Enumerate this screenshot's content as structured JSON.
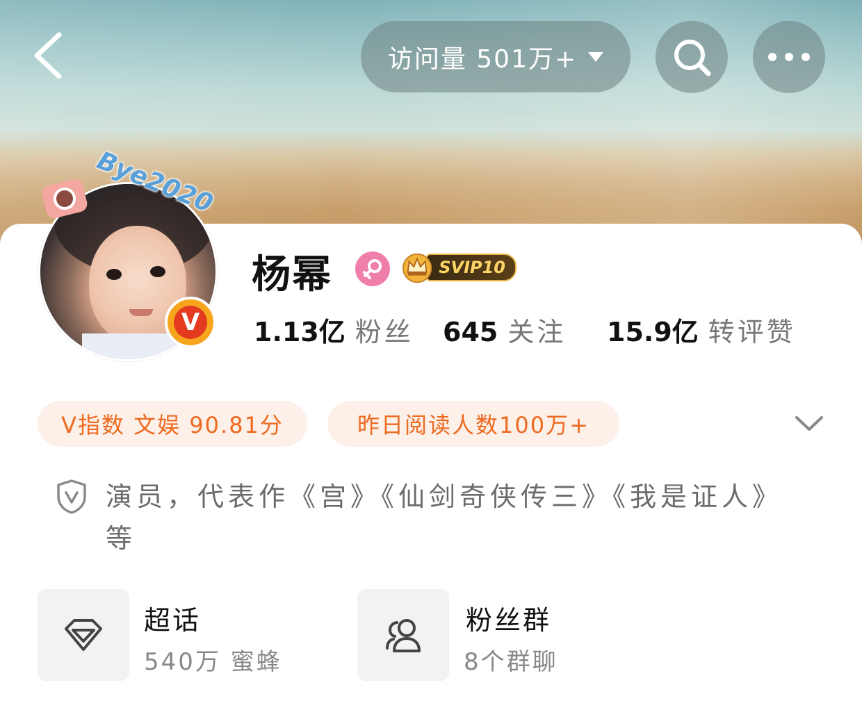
{
  "header": {
    "visits_label": "访问量 501万+",
    "icons": {
      "back": "chevron-left-icon",
      "visits_dropdown": "caret-down-icon",
      "search": "search-icon",
      "more": "more-horizontal-icon"
    }
  },
  "profile": {
    "username": "杨幂",
    "avatar_decoration_text": "Bye2020",
    "verified_badge_letter": "V",
    "gender_icon": "female-icon",
    "svip_label": "SVIP10",
    "stats": [
      {
        "value": "1.13亿",
        "label": "粉丝"
      },
      {
        "value": "645",
        "label": "关注"
      },
      {
        "value": "15.9亿",
        "label": "转评赞"
      }
    ]
  },
  "pills": {
    "v_index": "V指数 文娱 90.81分",
    "yesterday_reads": "昨日阅读人数100万+"
  },
  "bio": {
    "icon": "verified-shield-icon",
    "text": "演员，代表作《宫》《仙剑奇侠传三》《我是证人》等"
  },
  "tiles": [
    {
      "title": "超话",
      "subtitle": "540万 蜜蜂",
      "icon": "diamond-icon"
    },
    {
      "title": "粉丝群",
      "subtitle": "8个群聊",
      "icon": "group-icon"
    }
  ],
  "colors": {
    "accent_orange": "#ee6a1f",
    "pill_bg": "#fdf0e9",
    "gender_pink": "#f07eab",
    "verified_orange": "#f6a51c",
    "verified_red": "#e43a1f"
  }
}
